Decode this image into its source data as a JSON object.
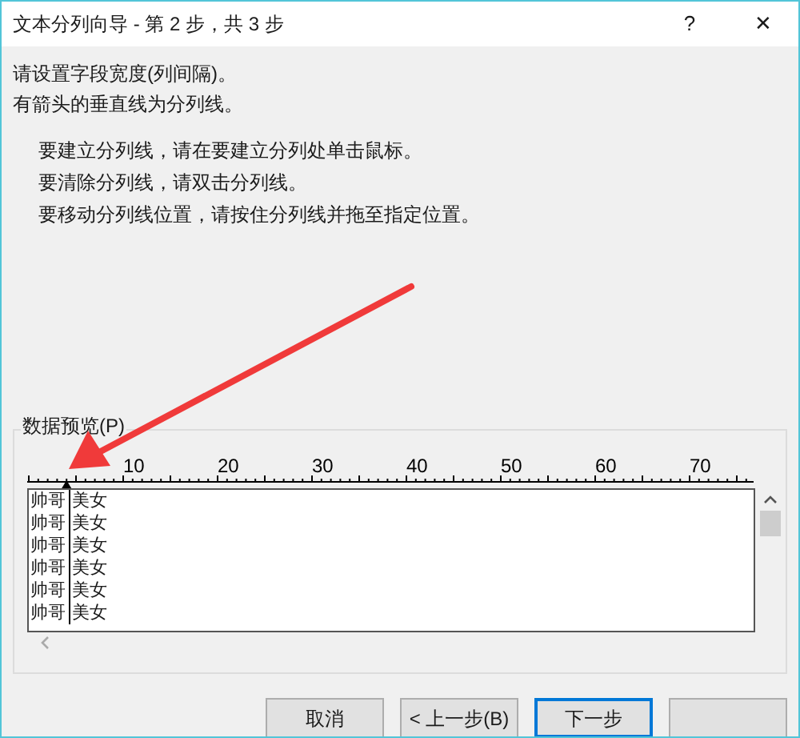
{
  "window": {
    "title": "文本分列向导 - 第 2 步，共 3 步",
    "help": "?",
    "close": "✕"
  },
  "intro": [
    "请设置字段宽度(列间隔)。",
    "有箭头的垂直线为分列线。"
  ],
  "instructions": [
    "要建立分列线，请在要建立分列处单击鼠标。",
    "要清除分列线，请双击分列线。",
    "要移动分列线位置，请按住分列线并拖至指定位置。"
  ],
  "preview": {
    "label": "数据预览(P)",
    "ruler": [
      "10",
      "20",
      "30",
      "40",
      "50",
      "60",
      "70"
    ],
    "rows": [
      {
        "cells": [
          "帅哥",
          "美女"
        ]
      },
      {
        "cells": [
          "帅哥",
          "美女"
        ]
      },
      {
        "cells": [
          "帅哥",
          "美女"
        ]
      },
      {
        "cells": [
          "帅哥",
          "美女"
        ]
      },
      {
        "cells": [
          "帅哥",
          "美女"
        ]
      },
      {
        "cells": [
          "帅哥",
          "美女"
        ]
      }
    ]
  },
  "buttons": [
    {
      "label": "取消",
      "default": false
    },
    {
      "label": "< 上一步(B)",
      "default": false
    },
    {
      "label": "下一步",
      "default": true
    },
    {
      "default": false
    }
  ]
}
